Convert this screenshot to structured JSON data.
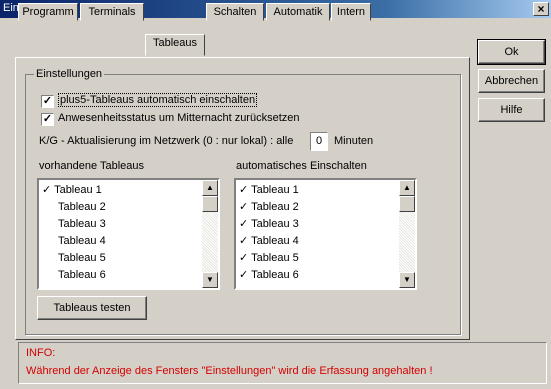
{
  "window": {
    "title": "Einstellungen",
    "close_glyph": "×"
  },
  "tabs": [
    {
      "label": "Programm"
    },
    {
      "label": "Terminals"
    },
    {
      "label": "Tableaus",
      "active": true
    },
    {
      "label": "Schalten"
    },
    {
      "label": "Automatik"
    },
    {
      "label": "Intern"
    }
  ],
  "group_label": "Einstellungen",
  "options": {
    "auto_on": {
      "label": "plus5-Tableaus automatisch einschalten",
      "checked": true
    },
    "reset_status": {
      "label": "Anwesenheitsstatus um Mitternacht zurücksetzen",
      "checked": true
    },
    "kg_update": {
      "label_before": "K/G - Aktualisierung im Netzwerk (0 : nur lokal) : alle",
      "value": "0",
      "label_after": "Minuten"
    }
  },
  "lists": {
    "available": {
      "header": "vorhandene Tableaus",
      "items": [
        "✓ Tableau 1",
        "Tableau 2",
        "Tableau 3",
        "Tableau 4",
        "Tableau 5",
        "Tableau 6"
      ]
    },
    "auto": {
      "header": "automatisches Einschalten",
      "items": [
        "✓ Tableau 1",
        "✓ Tableau 2",
        "✓ Tableau 3",
        "✓ Tableau 4",
        "✓ Tableau 5",
        "✓ Tableau 6"
      ]
    }
  },
  "test_button": "Tableaus testen",
  "buttons": {
    "ok": "Ok",
    "cancel": "Abbrechen",
    "help": "Hilfe"
  },
  "info": {
    "line1": "INFO:",
    "line2": "Während der Anzeige des Fensters \"Einstellungen\" wird die Erfassung angehalten !"
  },
  "icons": {
    "check": "✓",
    "scroll_up": "▲",
    "scroll_down": "▼"
  },
  "colors": {
    "titlebar_start": "#0a246a",
    "info_text": "#d40000",
    "face": "#d4d0c8"
  }
}
